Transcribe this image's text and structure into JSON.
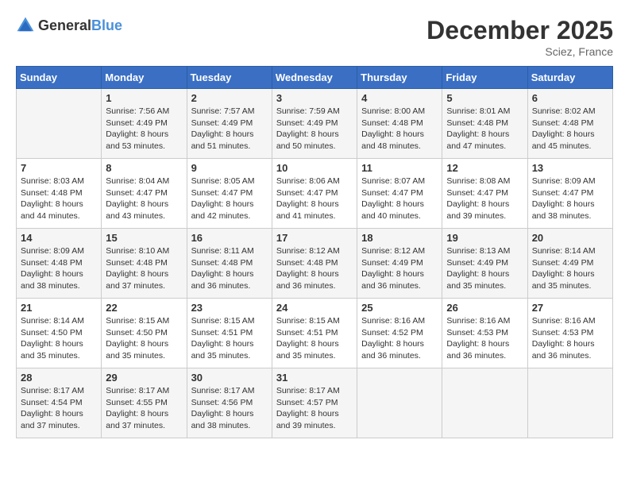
{
  "header": {
    "logo_general": "General",
    "logo_blue": "Blue",
    "title": "December 2025",
    "location": "Sciez, France"
  },
  "days_of_week": [
    "Sunday",
    "Monday",
    "Tuesday",
    "Wednesday",
    "Thursday",
    "Friday",
    "Saturday"
  ],
  "weeks": [
    [
      {
        "day": "",
        "info": ""
      },
      {
        "day": "1",
        "info": "Sunrise: 7:56 AM\nSunset: 4:49 PM\nDaylight: 8 hours\nand 53 minutes."
      },
      {
        "day": "2",
        "info": "Sunrise: 7:57 AM\nSunset: 4:49 PM\nDaylight: 8 hours\nand 51 minutes."
      },
      {
        "day": "3",
        "info": "Sunrise: 7:59 AM\nSunset: 4:49 PM\nDaylight: 8 hours\nand 50 minutes."
      },
      {
        "day": "4",
        "info": "Sunrise: 8:00 AM\nSunset: 4:48 PM\nDaylight: 8 hours\nand 48 minutes."
      },
      {
        "day": "5",
        "info": "Sunrise: 8:01 AM\nSunset: 4:48 PM\nDaylight: 8 hours\nand 47 minutes."
      },
      {
        "day": "6",
        "info": "Sunrise: 8:02 AM\nSunset: 4:48 PM\nDaylight: 8 hours\nand 45 minutes."
      }
    ],
    [
      {
        "day": "7",
        "info": "Sunrise: 8:03 AM\nSunset: 4:48 PM\nDaylight: 8 hours\nand 44 minutes."
      },
      {
        "day": "8",
        "info": "Sunrise: 8:04 AM\nSunset: 4:47 PM\nDaylight: 8 hours\nand 43 minutes."
      },
      {
        "day": "9",
        "info": "Sunrise: 8:05 AM\nSunset: 4:47 PM\nDaylight: 8 hours\nand 42 minutes."
      },
      {
        "day": "10",
        "info": "Sunrise: 8:06 AM\nSunset: 4:47 PM\nDaylight: 8 hours\nand 41 minutes."
      },
      {
        "day": "11",
        "info": "Sunrise: 8:07 AM\nSunset: 4:47 PM\nDaylight: 8 hours\nand 40 minutes."
      },
      {
        "day": "12",
        "info": "Sunrise: 8:08 AM\nSunset: 4:47 PM\nDaylight: 8 hours\nand 39 minutes."
      },
      {
        "day": "13",
        "info": "Sunrise: 8:09 AM\nSunset: 4:47 PM\nDaylight: 8 hours\nand 38 minutes."
      }
    ],
    [
      {
        "day": "14",
        "info": "Sunrise: 8:09 AM\nSunset: 4:48 PM\nDaylight: 8 hours\nand 38 minutes."
      },
      {
        "day": "15",
        "info": "Sunrise: 8:10 AM\nSunset: 4:48 PM\nDaylight: 8 hours\nand 37 minutes."
      },
      {
        "day": "16",
        "info": "Sunrise: 8:11 AM\nSunset: 4:48 PM\nDaylight: 8 hours\nand 36 minutes."
      },
      {
        "day": "17",
        "info": "Sunrise: 8:12 AM\nSunset: 4:48 PM\nDaylight: 8 hours\nand 36 minutes."
      },
      {
        "day": "18",
        "info": "Sunrise: 8:12 AM\nSunset: 4:49 PM\nDaylight: 8 hours\nand 36 minutes."
      },
      {
        "day": "19",
        "info": "Sunrise: 8:13 AM\nSunset: 4:49 PM\nDaylight: 8 hours\nand 35 minutes."
      },
      {
        "day": "20",
        "info": "Sunrise: 8:14 AM\nSunset: 4:49 PM\nDaylight: 8 hours\nand 35 minutes."
      }
    ],
    [
      {
        "day": "21",
        "info": "Sunrise: 8:14 AM\nSunset: 4:50 PM\nDaylight: 8 hours\nand 35 minutes."
      },
      {
        "day": "22",
        "info": "Sunrise: 8:15 AM\nSunset: 4:50 PM\nDaylight: 8 hours\nand 35 minutes."
      },
      {
        "day": "23",
        "info": "Sunrise: 8:15 AM\nSunset: 4:51 PM\nDaylight: 8 hours\nand 35 minutes."
      },
      {
        "day": "24",
        "info": "Sunrise: 8:15 AM\nSunset: 4:51 PM\nDaylight: 8 hours\nand 35 minutes."
      },
      {
        "day": "25",
        "info": "Sunrise: 8:16 AM\nSunset: 4:52 PM\nDaylight: 8 hours\nand 36 minutes."
      },
      {
        "day": "26",
        "info": "Sunrise: 8:16 AM\nSunset: 4:53 PM\nDaylight: 8 hours\nand 36 minutes."
      },
      {
        "day": "27",
        "info": "Sunrise: 8:16 AM\nSunset: 4:53 PM\nDaylight: 8 hours\nand 36 minutes."
      }
    ],
    [
      {
        "day": "28",
        "info": "Sunrise: 8:17 AM\nSunset: 4:54 PM\nDaylight: 8 hours\nand 37 minutes."
      },
      {
        "day": "29",
        "info": "Sunrise: 8:17 AM\nSunset: 4:55 PM\nDaylight: 8 hours\nand 37 minutes."
      },
      {
        "day": "30",
        "info": "Sunrise: 8:17 AM\nSunset: 4:56 PM\nDaylight: 8 hours\nand 38 minutes."
      },
      {
        "day": "31",
        "info": "Sunrise: 8:17 AM\nSunset: 4:57 PM\nDaylight: 8 hours\nand 39 minutes."
      },
      {
        "day": "",
        "info": ""
      },
      {
        "day": "",
        "info": ""
      },
      {
        "day": "",
        "info": ""
      }
    ]
  ]
}
